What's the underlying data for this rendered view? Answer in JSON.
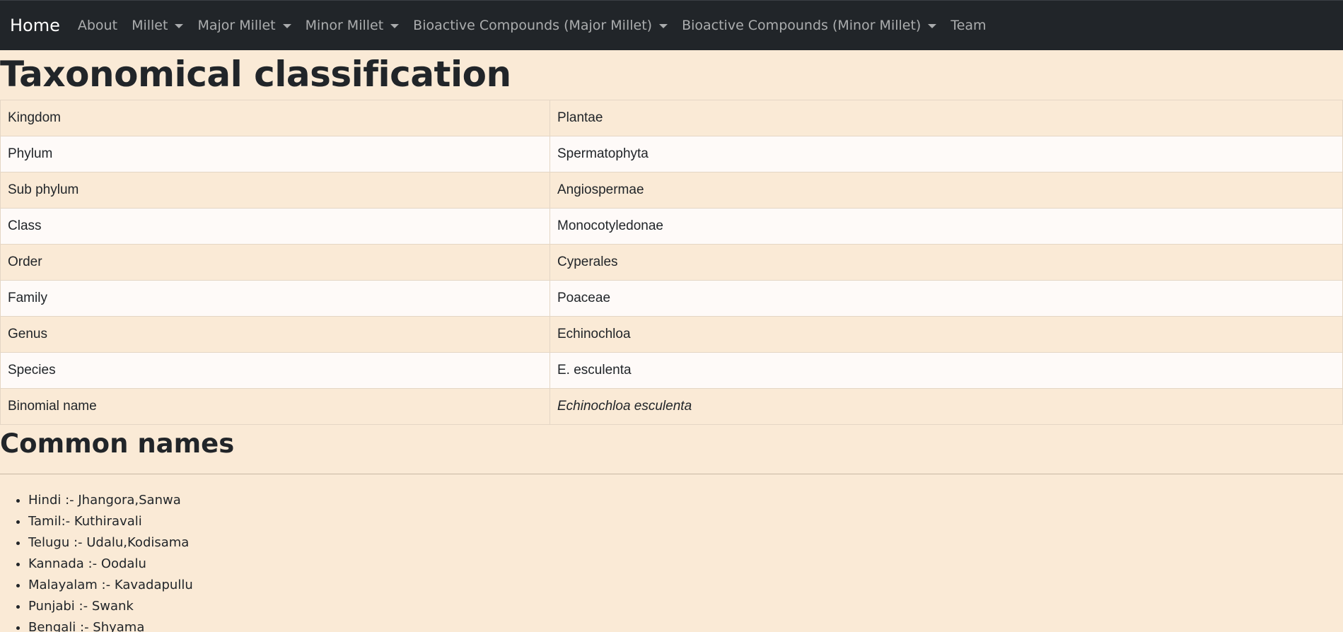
{
  "navbar": {
    "brand": "Home",
    "items": [
      {
        "label": "About",
        "dropdown": false
      },
      {
        "label": "Millet",
        "dropdown": true
      },
      {
        "label": "Major Millet",
        "dropdown": true
      },
      {
        "label": "Minor Millet",
        "dropdown": true
      },
      {
        "label": "Bioactive Compounds (Major Millet)",
        "dropdown": true
      },
      {
        "label": "Bioactive Compounds (Minor Millet)",
        "dropdown": true
      },
      {
        "label": "Team",
        "dropdown": false
      }
    ]
  },
  "taxonomy": {
    "title": "Taxonomical classification",
    "rows": [
      {
        "rank": "Kingdom",
        "value": "Plantae"
      },
      {
        "rank": "Phylum",
        "value": "Spermatophyta"
      },
      {
        "rank": "Sub phylum",
        "value": "Angiospermae"
      },
      {
        "rank": "Class",
        "value": "Monocotyledonae"
      },
      {
        "rank": "Order",
        "value": "Cyperales"
      },
      {
        "rank": "Family",
        "value": "Poaceae"
      },
      {
        "rank": "Genus",
        "value": "Echinochloa"
      },
      {
        "rank": "Species",
        "value": "E. esculenta"
      },
      {
        "rank": "Binomial name",
        "value": "Echinochloa esculenta"
      }
    ]
  },
  "common_names": {
    "title": "Common names",
    "items": [
      "Hindi :- Jhangora,Sanwa",
      "Tamil:- Kuthiravali",
      "Telugu :- Udalu,Kodisama",
      "Kannada :- Oodalu",
      "Malayalam :- Kavadapullu",
      "Punjabi :- Swank",
      "Bengali :- Shyama"
    ]
  }
}
